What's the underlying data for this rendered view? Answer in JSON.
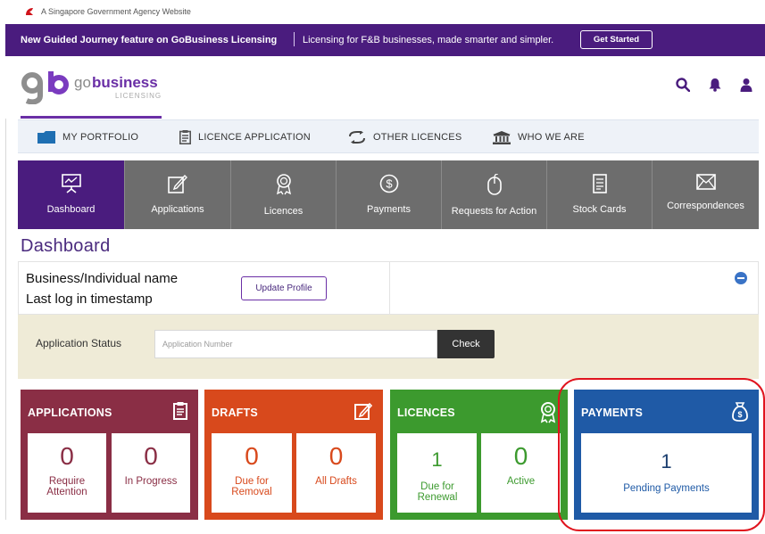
{
  "gov_strip": {
    "text": "A Singapore Government Agency Website"
  },
  "promo": {
    "headline": "New Guided Journey feature on GoBusiness Licensing",
    "subline": "Licensing for F&B businesses, made smarter and simpler.",
    "cta": "Get Started"
  },
  "header": {
    "logo_primary": "gobusiness",
    "logo_secondary": "LICENSING"
  },
  "subnav": [
    {
      "label": "MY PORTFOLIO",
      "icon": "folder-icon"
    },
    {
      "label": "LICENCE APPLICATION",
      "icon": "clipboard-icon"
    },
    {
      "label": "OTHER LICENCES",
      "icon": "arrows-swap-icon"
    },
    {
      "label": "WHO WE ARE",
      "icon": "institution-icon"
    }
  ],
  "tiles": [
    {
      "label": "Dashboard",
      "icon": "presentation-icon",
      "active": true
    },
    {
      "label": "Applications",
      "icon": "edit-icon"
    },
    {
      "label": "Licences",
      "icon": "award-icon"
    },
    {
      "label": "Payments",
      "icon": "dollar-icon"
    },
    {
      "label": "Requests for Action",
      "icon": "mouse-icon"
    },
    {
      "label": "Stock Cards",
      "icon": "document-icon"
    },
    {
      "label": "Correspondences",
      "icon": "envelope-icon"
    }
  ],
  "dashboard": {
    "title": "Dashboard",
    "business_name": "Business/Individual name",
    "last_log": "Last log in timestamp",
    "update_profile": "Update Profile",
    "status_label": "Application Status",
    "app_number_placeholder": "Application Number",
    "check": "Check"
  },
  "cards": {
    "applications": {
      "title": "APPLICATIONS",
      "stats": [
        {
          "value": "0",
          "label": "Require Attention"
        },
        {
          "value": "0",
          "label": "In Progress"
        }
      ]
    },
    "drafts": {
      "title": "DRAFTS",
      "stats": [
        {
          "value": "0",
          "label": "Due for Removal"
        },
        {
          "value": "0",
          "label": "All Drafts"
        }
      ]
    },
    "licences": {
      "title": "LICENCES",
      "stats": [
        {
          "value": "1",
          "label": "Due for Renewal"
        },
        {
          "value": "0",
          "label": "Active"
        }
      ]
    },
    "payments": {
      "title": "PAYMENTS",
      "stats": [
        {
          "value": "1",
          "label": "Pending Payments"
        }
      ]
    }
  },
  "colors": {
    "brand_purple": "#4a1c7e",
    "applications": "#8a2e45",
    "drafts": "#d8491c",
    "licences": "#3c9a2e",
    "payments": "#1f5aa6",
    "highlight": "#e0141e"
  }
}
